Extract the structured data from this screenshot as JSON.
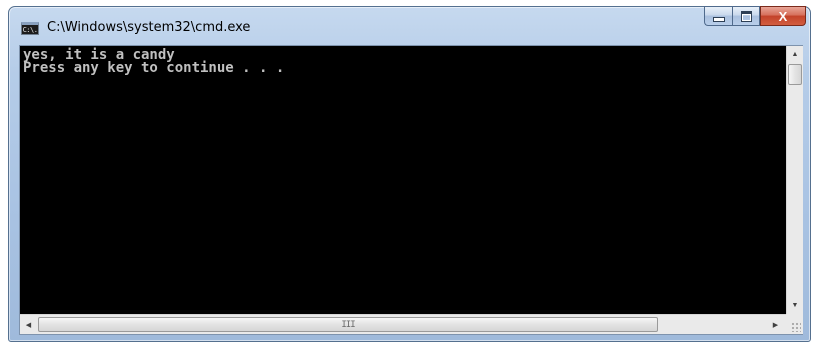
{
  "window": {
    "title": "C:\\Windows\\system32\\cmd.exe",
    "icon_name": "cmd-icon",
    "icon_text": "C:\\."
  },
  "caption_buttons": {
    "minimize_icon": "minimize-icon",
    "maximize_icon": "maximize-icon",
    "close_icon": "close-icon",
    "close_glyph": "X"
  },
  "console": {
    "lines": [
      "yes, it is a candy",
      "Press any key to continue . . ."
    ],
    "background": "#000000",
    "text_color": "#c0c0c0"
  },
  "scrollbars": {
    "vertical": {
      "up_glyph": "▲",
      "down_glyph": "▼"
    },
    "horizontal": {
      "left_glyph": "◀",
      "right_glyph": "▶",
      "grip_glyph": "III"
    }
  },
  "colors": {
    "title_bar": "#b5cce8",
    "close_button": "#c3422a"
  }
}
